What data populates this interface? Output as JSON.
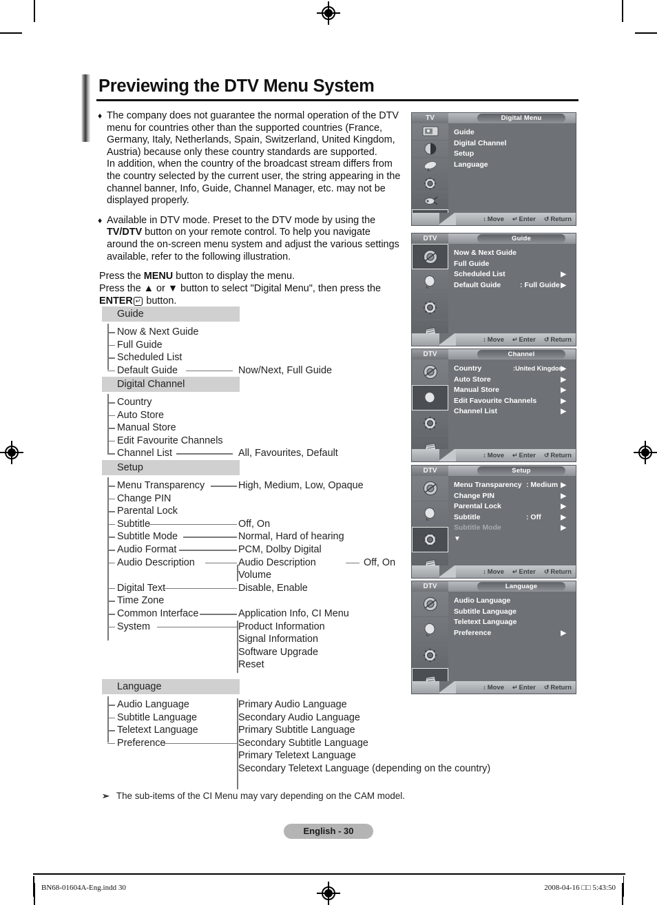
{
  "header": {
    "title": "Previewing the DTV Menu System"
  },
  "body": {
    "bullet1": "The company does not guarantee the normal operation of the DTV menu for countries other than the supported countries (France, Germany, Italy, Netherlands, Spain, Switzerland, United Kingdom, Austria) because only these country standards are supported.",
    "bullet1b": "In addition, when the country of the broadcast stream differs from the country selected by the current user, the string appearing in the channel banner, Info, Guide, Channel Manager, etc. may not be displayed properly.",
    "bullet2_a": "Available in DTV mode. Preset to the DTV mode by using the ",
    "bullet2_bold": "TV/DTV",
    "bullet2_b": " button on your remote control. To help you navigate around the on-screen menu system and adjust the various settings available, refer to the following illustration.",
    "press1_a": "Press the ",
    "press1_bold": "MENU",
    "press1_b": " button to display the menu.",
    "press2_a": "Press the ▲ or ▼ button to select \"Digital Menu\", then press the ",
    "press2_bold": "ENTER",
    "press2_b": " button.",
    "bullet_mark": "♦"
  },
  "tree": {
    "groups": [
      {
        "name": "Guide",
        "items": [
          {
            "label": "Now & Next Guide",
            "leader": false,
            "right": ""
          },
          {
            "label": "Full Guide",
            "leader": false,
            "right": ""
          },
          {
            "label": "Scheduled List",
            "leader": false,
            "right": ""
          },
          {
            "label": "Default Guide",
            "leader": true,
            "right": "Now/Next, Full Guide"
          }
        ]
      },
      {
        "name": "Digital Channel",
        "items": [
          {
            "label": "Country",
            "leader": false,
            "right": ""
          },
          {
            "label": "Auto Store",
            "leader": false,
            "right": ""
          },
          {
            "label": "Manual Store",
            "leader": false,
            "right": ""
          },
          {
            "label": "Edit Favourite Channels",
            "leader": false,
            "right": ""
          },
          {
            "label": "Channel List",
            "leader": true,
            "right": "All, Favourites, Default"
          }
        ]
      },
      {
        "name": "Setup",
        "items": [
          {
            "label": "Menu Transparency",
            "leader": true,
            "right": "High, Medium, Low, Opaque"
          },
          {
            "label": "Change PIN",
            "leader": false,
            "right": ""
          },
          {
            "label": "Parental Lock",
            "leader": false,
            "right": ""
          },
          {
            "label": "Subtitle",
            "leader": true,
            "right": "Off, On"
          },
          {
            "label": "Subtitle Mode",
            "leader": true,
            "right": "Normal, Hard of hearing"
          },
          {
            "label": "Audio Format",
            "leader": true,
            "right": "PCM, Dolby Digital"
          },
          {
            "label": "Audio Description",
            "leader": true,
            "right": "Audio Description"
          },
          {
            "label": "",
            "leader": false,
            "right": "Volume"
          },
          {
            "label": "Digital Text",
            "leader": true,
            "right": "Disable, Enable"
          },
          {
            "label": "Time Zone",
            "leader": false,
            "right": ""
          },
          {
            "label": "Common Interface",
            "leader": true,
            "right": "Application Info, CI Menu"
          },
          {
            "label": "System",
            "leader": true,
            "right": "Product Information"
          },
          {
            "label": "",
            "leader": false,
            "right": "Signal Information"
          },
          {
            "label": "",
            "leader": false,
            "right": "Software Upgrade"
          },
          {
            "label": "",
            "leader": false,
            "right": "Reset"
          }
        ]
      },
      {
        "name": "Language",
        "items": [
          {
            "label": "Audio Language",
            "leader": false,
            "right": "Primary Audio Language"
          },
          {
            "label": "Subtitle Language",
            "leader": false,
            "right": "Secondary Audio Language"
          },
          {
            "label": "Teletext Language",
            "leader": false,
            "right": "Primary Subtitle Language"
          },
          {
            "label": "Preference",
            "leader": true,
            "right": "Secondary Subtitle Language"
          },
          {
            "label": "",
            "leader": false,
            "right": "Primary Teletext Language"
          },
          {
            "label": "",
            "leader": false,
            "right": "Secondary Teletext Language (depending on the country)"
          }
        ]
      }
    ],
    "audio_desc_suffix": "Off, On"
  },
  "note": {
    "glyph": "➢",
    "text": "The sub-items of the CI Menu may vary depending on the CAM model."
  },
  "tv_shots": [
    {
      "mode": "TV",
      "title": "Digital Menu",
      "icons": [
        "picture-icon",
        "sound-icon",
        "dish-icon",
        "setup-gear-icon",
        "input-icon",
        "digital-menu-icon"
      ],
      "selected_icon": 5,
      "rows": [
        {
          "label": "Guide",
          "value": "",
          "arrow": false,
          "dim": false
        },
        {
          "label": "Digital Channel",
          "value": "",
          "arrow": false,
          "dim": false
        },
        {
          "label": "Setup",
          "value": "",
          "arrow": false,
          "dim": false
        },
        {
          "label": "Language",
          "value": "",
          "arrow": false,
          "dim": false
        }
      ],
      "hints": {
        "move": "Move",
        "enter": "Enter",
        "return": "Return"
      }
    },
    {
      "mode": "DTV",
      "title": "Guide",
      "icons": [
        "guide-icon",
        "channel-icon",
        "setup-gear-icon",
        "language-icon"
      ],
      "selected_icon": 0,
      "rows": [
        {
          "label": "Now & Next Guide",
          "value": "",
          "arrow": false,
          "dim": false
        },
        {
          "label": "Full Guide",
          "value": "",
          "arrow": false,
          "dim": false
        },
        {
          "label": "Scheduled List",
          "value": "",
          "arrow": true,
          "dim": false
        },
        {
          "label": "Default Guide",
          "value": ": Full Guide",
          "arrow": true,
          "dim": false
        }
      ],
      "hints": {
        "move": "Move",
        "enter": "Enter",
        "return": "Return"
      }
    },
    {
      "mode": "DTV",
      "title": "Channel",
      "icons": [
        "guide-icon",
        "channel-icon",
        "setup-gear-icon",
        "language-icon"
      ],
      "selected_icon": 1,
      "rows": [
        {
          "label": "Country",
          "value": ":United Kingdom",
          "arrow": true,
          "dim": false,
          "small": true
        },
        {
          "label": "Auto Store",
          "value": "",
          "arrow": true,
          "dim": false
        },
        {
          "label": "Manual Store",
          "value": "",
          "arrow": true,
          "dim": false
        },
        {
          "label": "Edit Favourite Channels",
          "value": "",
          "arrow": true,
          "dim": false
        },
        {
          "label": "Channel List",
          "value": "",
          "arrow": true,
          "dim": false
        }
      ],
      "hints": {
        "move": "Move",
        "enter": "Enter",
        "return": "Return"
      }
    },
    {
      "mode": "DTV",
      "title": "Setup",
      "icons": [
        "guide-icon",
        "channel-icon",
        "setup-gear-icon",
        "language-icon"
      ],
      "selected_icon": 2,
      "rows": [
        {
          "label": "Menu Transparency",
          "value": ": Medium",
          "arrow": true,
          "dim": false,
          "valshift": true
        },
        {
          "label": "Change PIN",
          "value": "",
          "arrow": true,
          "dim": false
        },
        {
          "label": "Parental Lock",
          "value": "",
          "arrow": true,
          "dim": false
        },
        {
          "label": "Subtitle",
          "value": ": Off",
          "arrow": true,
          "dim": false
        },
        {
          "label": "Subtitle  Mode",
          "value": "",
          "arrow": true,
          "dim": true
        },
        {
          "label": "▼",
          "value": "",
          "arrow": false,
          "dim": false
        }
      ],
      "hints": {
        "move": "Move",
        "enter": "Enter",
        "return": "Return"
      }
    },
    {
      "mode": "DTV",
      "title": "Language",
      "icons": [
        "guide-icon",
        "channel-icon",
        "setup-gear-icon",
        "language-icon"
      ],
      "selected_icon": 3,
      "rows": [
        {
          "label": "Audio Language",
          "value": "",
          "arrow": false,
          "dim": false
        },
        {
          "label": "Subtitle Language",
          "value": "",
          "arrow": false,
          "dim": false
        },
        {
          "label": "Teletext Language",
          "value": "",
          "arrow": false,
          "dim": false
        },
        {
          "label": "Preference",
          "value": "",
          "arrow": true,
          "dim": false
        }
      ],
      "hints": {
        "move": "Move",
        "enter": "Enter",
        "return": "Return"
      }
    }
  ],
  "footer": {
    "page_label": "English - 30",
    "file_ref": "BN68-01604A-Eng.indd   30",
    "timestamp": "2008-04-16   □□ 5:43:50"
  },
  "colors": {
    "group_header_bg": "#d0d0d0",
    "page_pill_bg": "#b4b4b4",
    "tv_body_bg": "#6e7276"
  }
}
